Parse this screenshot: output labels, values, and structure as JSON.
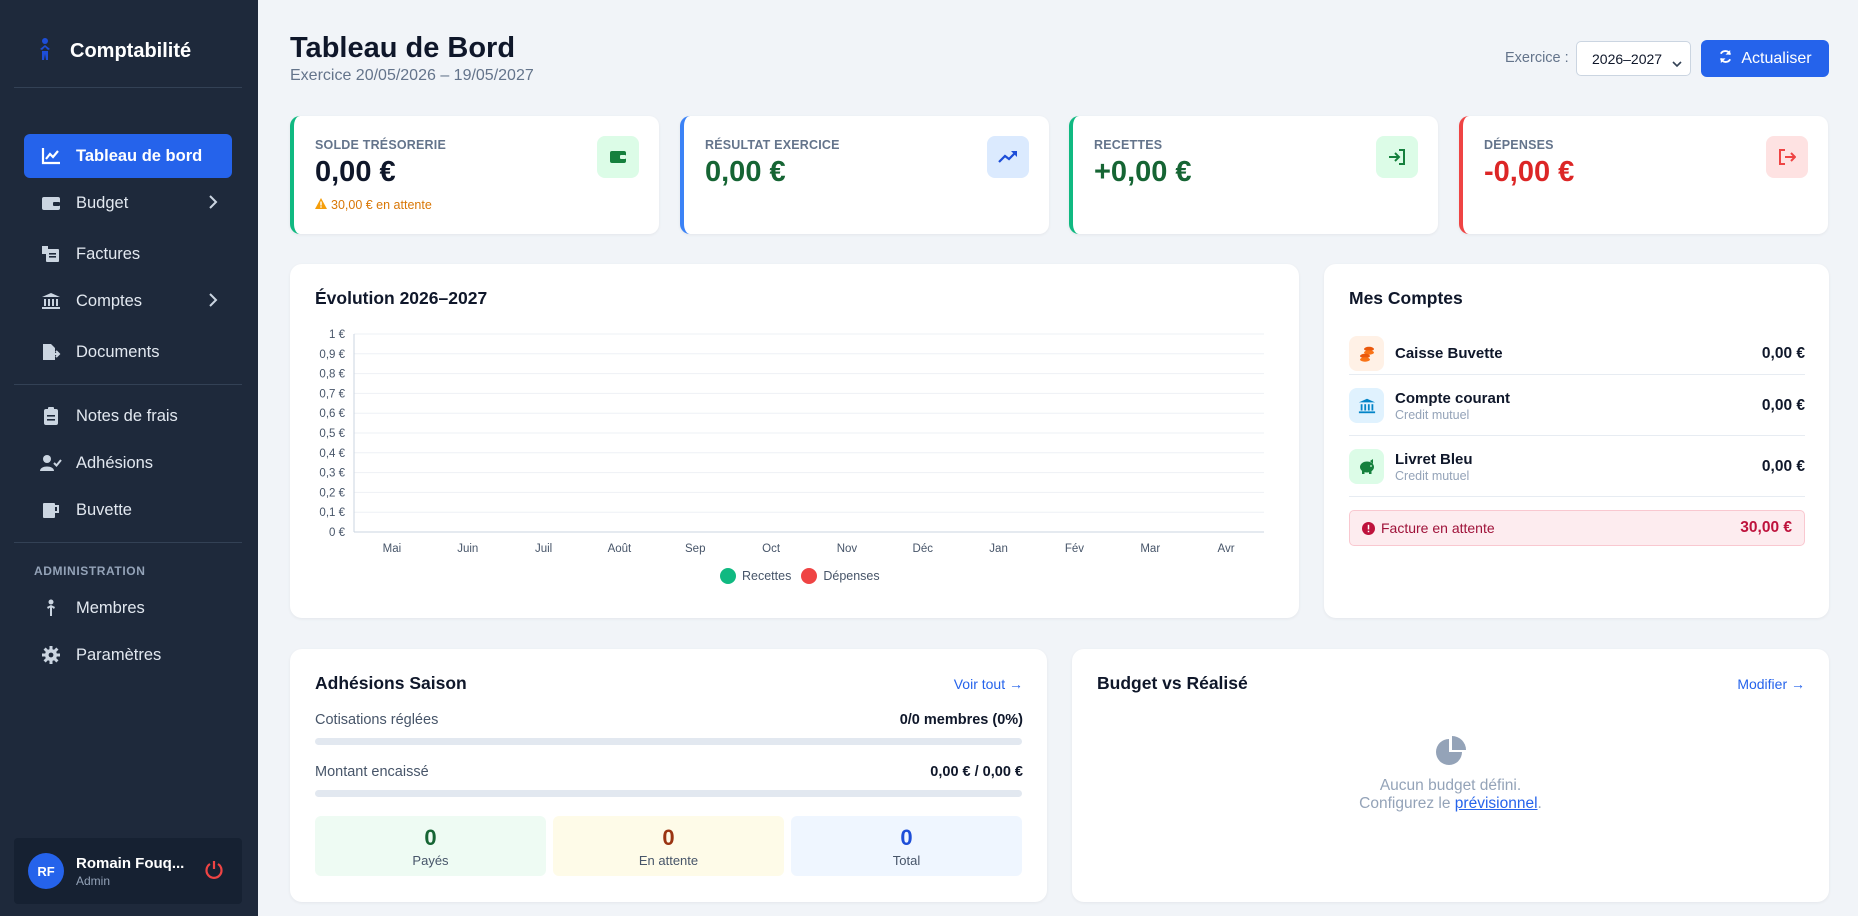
{
  "brand": {
    "title": "Comptabilité"
  },
  "sidebar": {
    "items": [
      {
        "label": "Tableau de bord"
      },
      {
        "label": "Budget"
      },
      {
        "label": "Factures"
      },
      {
        "label": "Comptes"
      },
      {
        "label": "Documents"
      },
      {
        "label": "Notes de frais"
      },
      {
        "label": "Adhésions"
      },
      {
        "label": "Buvette"
      }
    ],
    "admin_section": "ADMINISTRATION",
    "admin_items": [
      {
        "label": "Membres"
      },
      {
        "label": "Paramètres"
      }
    ],
    "user": {
      "initials": "RF",
      "name": "Romain Fouq...",
      "role": "Admin"
    }
  },
  "header": {
    "title": "Tableau de Bord",
    "subtitle": "Exercice 20/05/2026 – 19/05/2027",
    "exercise_label": "Exercice :",
    "exercise_value": "2026–2027",
    "refresh_label": "Actualiser"
  },
  "kpis": [
    {
      "label": "SOLDE TRÉSORERIE",
      "value": "0,00 €",
      "note": "30,00 € en attente",
      "color": "#10b981"
    },
    {
      "label": "RÉSULTAT EXERCICE",
      "value": "0,00 €",
      "color": "#3b82f6"
    },
    {
      "label": "RECETTES",
      "value": "+0,00 €",
      "color": "#10b981"
    },
    {
      "label": "DÉPENSES",
      "value": "-0,00 €",
      "color": "#ef4444"
    }
  ],
  "chart": {
    "title": "Évolution 2026–2027"
  },
  "chart_data": {
    "type": "line",
    "categories": [
      "Mai",
      "Juin",
      "Juil",
      "Août",
      "Sep",
      "Oct",
      "Nov",
      "Déc",
      "Jan",
      "Fév",
      "Mar",
      "Avr"
    ],
    "y_ticks": [
      "0 €",
      "0,1 €",
      "0,2 €",
      "0,3 €",
      "0,4 €",
      "0,5 €",
      "0,6 €",
      "0,7 €",
      "0,8 €",
      "0,9 €",
      "1 €"
    ],
    "ylim": [
      0,
      1
    ],
    "series": [
      {
        "name": "Recettes",
        "color": "#10b981",
        "values": [
          0,
          0,
          0,
          0,
          0,
          0,
          0,
          0,
          0,
          0,
          0,
          0
        ]
      },
      {
        "name": "Dépenses",
        "color": "#ef4444",
        "values": [
          0,
          0,
          0,
          0,
          0,
          0,
          0,
          0,
          0,
          0,
          0,
          0
        ]
      }
    ],
    "legend_position": "bottom",
    "grid": true
  },
  "accounts": {
    "title": "Mes Comptes",
    "items": [
      {
        "name": "Caisse Buvette",
        "sub": "",
        "amount": "0,00 €",
        "icon": "coins-icon"
      },
      {
        "name": "Compte courant",
        "sub": "Credit mutuel",
        "amount": "0,00 €",
        "icon": "bank-icon"
      },
      {
        "name": "Livret Bleu",
        "sub": "Credit mutuel",
        "amount": "0,00 €",
        "icon": "piggy-bank-icon"
      }
    ],
    "pending_label": "Facture en attente",
    "pending_amount": "30,00 €"
  },
  "adhesions": {
    "title": "Adhésions Saison",
    "link": "Voir tout →",
    "cotisations_label": "Cotisations réglées",
    "cotisations_value": "0/0 membres (0%)",
    "cotisations_progress": 0,
    "montant_label": "Montant encaissé",
    "montant_value": "0,00 € / 0,00 €",
    "montant_progress": 0,
    "stats": [
      {
        "value": "0",
        "label": "Payés"
      },
      {
        "value": "0",
        "label": "En attente"
      },
      {
        "value": "0",
        "label": "Total"
      }
    ]
  },
  "budget": {
    "title": "Budget vs Réalisé",
    "link": "Modifier →",
    "empty_line1": "Aucun budget défini.",
    "empty_line2_prefix": "Configurez le ",
    "empty_link": "prévisionnel",
    "empty_line2_suffix": "."
  }
}
